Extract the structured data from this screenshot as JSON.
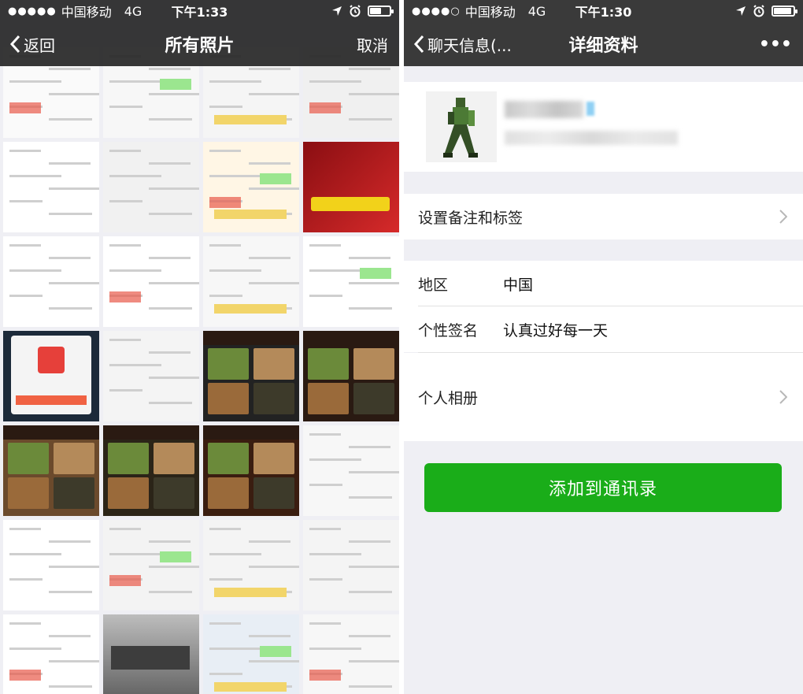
{
  "left": {
    "status": {
      "signal": "●●●●●",
      "carrier": "中国移动",
      "network": "4G",
      "time": "下午1:33"
    },
    "nav": {
      "back_label": "返回",
      "title": "所有照片",
      "cancel_label": "取消"
    },
    "photos": [
      {
        "tint": "#fafafa"
      },
      {
        "tint": "#f7f7f7"
      },
      {
        "tint": "#f5f5f5"
      },
      {
        "tint": "#f0f0f0"
      },
      {
        "tint": "#ffffff"
      },
      {
        "tint": "#f1f1f1"
      },
      {
        "tint": "#fff6e5"
      },
      {
        "tint": "#c2181c"
      },
      {
        "tint": "#ffffff"
      },
      {
        "tint": "#ffffff"
      },
      {
        "tint": "#f7f7f7"
      },
      {
        "tint": "#ffffff"
      },
      {
        "tint": "#1c2a3a"
      },
      {
        "tint": "#f4f4f4"
      },
      {
        "tint": "#222222"
      },
      {
        "tint": "#2a1a12"
      },
      {
        "tint": "#6b4a2c"
      },
      {
        "tint": "#2b2418"
      },
      {
        "tint": "#3a1d10"
      },
      {
        "tint": "#f7f7f7"
      },
      {
        "tint": "#ffffff"
      },
      {
        "tint": "#f3f3f3"
      },
      {
        "tint": "#f4f4f4"
      },
      {
        "tint": "#f4f4f4"
      },
      {
        "tint": "#ffffff"
      },
      {
        "tint": "#9a9a9a"
      },
      {
        "tint": "#e8eef5"
      },
      {
        "tint": "#f7f7f7"
      }
    ]
  },
  "right": {
    "status": {
      "signal": "●●●●○",
      "carrier": "中国移动",
      "network": "4G",
      "time": "下午1:30"
    },
    "nav": {
      "back_label": "聊天信息(...",
      "title": "详细资料",
      "more_label": "•••"
    },
    "rows": {
      "remark": "设置备注和标签",
      "region_label": "地区",
      "region_value": "中国",
      "signature_label": "个性签名",
      "signature_value": "认真过好每一天",
      "album": "个人相册"
    },
    "add_button": "添加到通讯录"
  },
  "colors": {
    "wechat_green": "#1aad19",
    "navbar": "#3a3a3a",
    "background": "#efeff4"
  }
}
